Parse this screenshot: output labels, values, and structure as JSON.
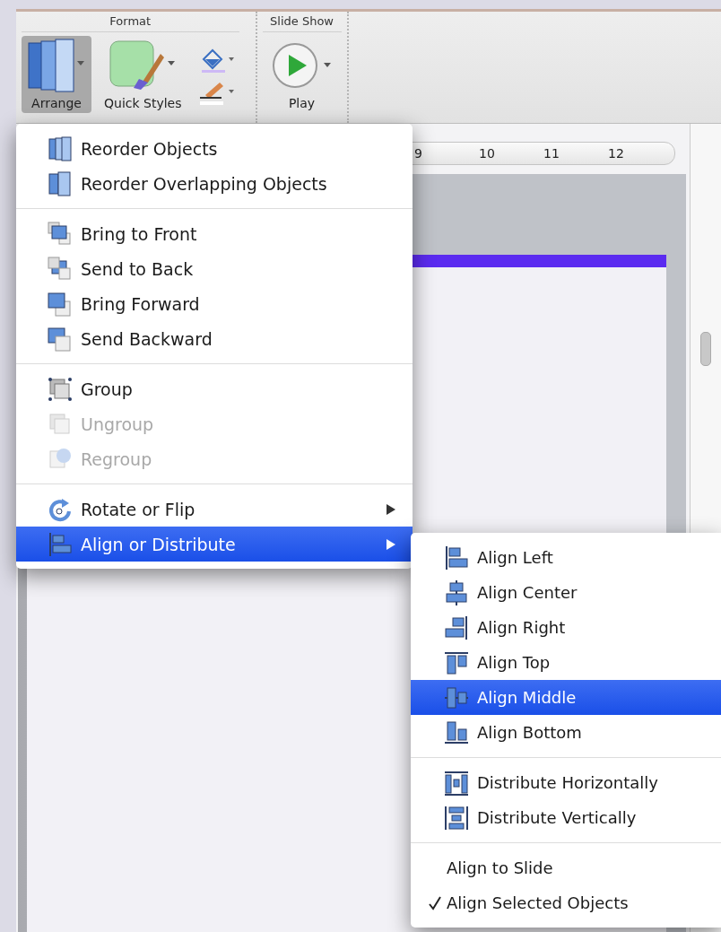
{
  "ribbon": {
    "groups": [
      {
        "title": "Format",
        "buttons": [
          {
            "kind": "large",
            "label": "Arrange",
            "selected": true
          },
          {
            "kind": "large",
            "label": "Quick Styles",
            "selected": false
          },
          {
            "kind": "color-stack",
            "selected": false
          }
        ]
      },
      {
        "title": "Slide Show",
        "buttons": [
          {
            "kind": "play",
            "label": "Play",
            "selected": false
          }
        ]
      }
    ]
  },
  "ruler": {
    "ticks": [
      "9",
      "10",
      "11",
      "12"
    ]
  },
  "menu": {
    "sections": [
      [
        {
          "label": "Reorder Objects",
          "disabled": false,
          "submenu": false,
          "selected": false
        },
        {
          "label": "Reorder Overlapping Objects",
          "disabled": false,
          "submenu": false,
          "selected": false
        }
      ],
      [
        {
          "label": "Bring to Front",
          "disabled": false,
          "submenu": false,
          "selected": false
        },
        {
          "label": "Send to Back",
          "disabled": false,
          "submenu": false,
          "selected": false
        },
        {
          "label": "Bring Forward",
          "disabled": false,
          "submenu": false,
          "selected": false
        },
        {
          "label": "Send Backward",
          "disabled": false,
          "submenu": false,
          "selected": false
        }
      ],
      [
        {
          "label": "Group",
          "disabled": false,
          "submenu": false,
          "selected": false
        },
        {
          "label": "Ungroup",
          "disabled": true,
          "submenu": false,
          "selected": false
        },
        {
          "label": "Regroup",
          "disabled": true,
          "submenu": false,
          "selected": false
        }
      ],
      [
        {
          "label": "Rotate or Flip",
          "disabled": false,
          "submenu": true,
          "selected": false
        },
        {
          "label": "Align or Distribute",
          "disabled": false,
          "submenu": true,
          "selected": true
        }
      ]
    ]
  },
  "submenu": {
    "sections": [
      [
        {
          "kind": "icon",
          "label": "Align Left",
          "selected": false
        },
        {
          "kind": "icon",
          "label": "Align Center",
          "selected": false
        },
        {
          "kind": "icon",
          "label": "Align Right",
          "selected": false
        },
        {
          "kind": "icon",
          "label": "Align Top",
          "selected": false
        },
        {
          "kind": "icon",
          "label": "Align Middle",
          "selected": true
        },
        {
          "kind": "icon",
          "label": "Align Bottom",
          "selected": false
        }
      ],
      [
        {
          "kind": "icon",
          "label": "Distribute Horizontally",
          "selected": false
        },
        {
          "kind": "icon",
          "label": "Distribute Vertically",
          "selected": false
        }
      ],
      [
        {
          "kind": "check",
          "label": "Align to Slide",
          "checked": false,
          "selected": false
        },
        {
          "kind": "check",
          "label": "Align Selected Objects",
          "checked": true,
          "selected": false
        }
      ]
    ]
  }
}
